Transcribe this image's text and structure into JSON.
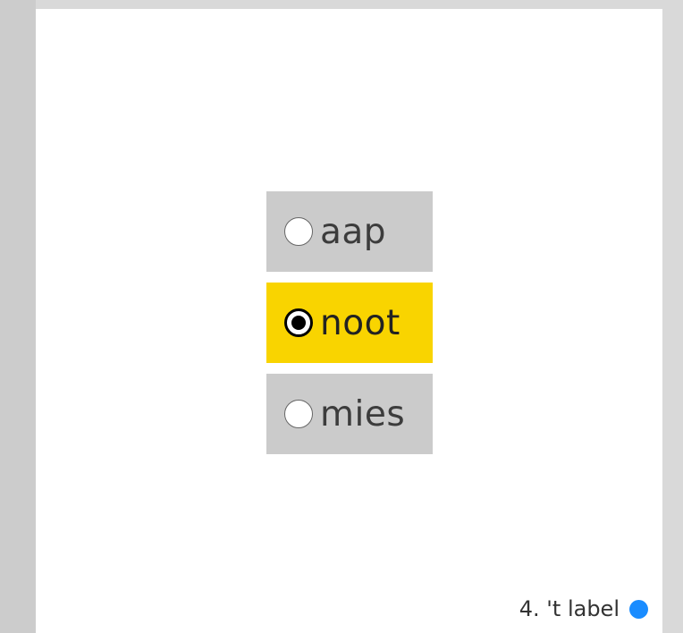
{
  "options": [
    {
      "label": "aap",
      "selected": false
    },
    {
      "label": "noot",
      "selected": true
    },
    {
      "label": "mies",
      "selected": false
    }
  ],
  "footer": {
    "label": "4. 't label",
    "dot_color": "#1a8cff"
  },
  "colors": {
    "selected_bg": "#f9d400",
    "unselected_bg": "#cbcbcb"
  }
}
